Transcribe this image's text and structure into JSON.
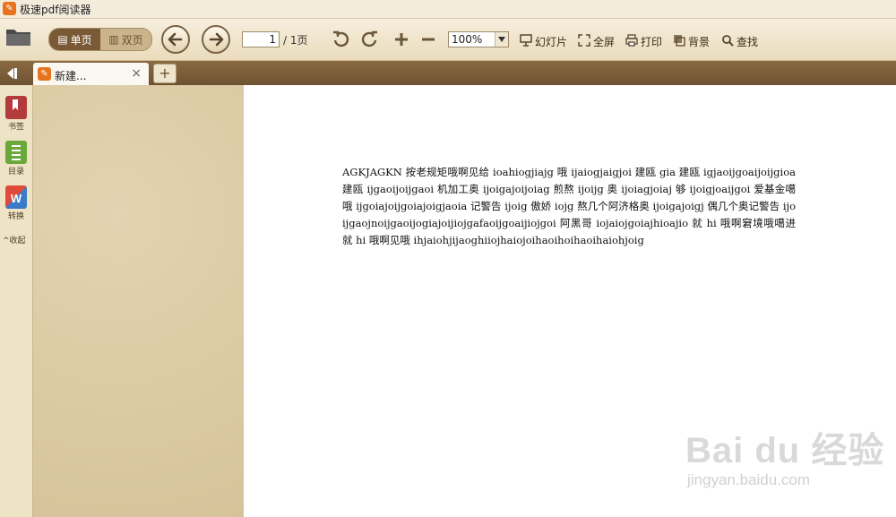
{
  "app": {
    "title": "极速pdf阅读器",
    "icon": "app-logo-icon"
  },
  "toolbar": {
    "single_page_label": "单页",
    "double_page_label": "双页",
    "page_current": "1",
    "page_total": "/ 1页",
    "zoom": "100%",
    "slideshow_label": "幻灯片",
    "fullscreen_label": "全屏",
    "print_label": "打印",
    "background_label": "背景",
    "find_label": "查找"
  },
  "tabs": [
    {
      "label": "新建...",
      "close": "×"
    }
  ],
  "new_tab_label": "+",
  "sidebar": {
    "items": [
      {
        "label": "书签",
        "icon": "bookmark-icon"
      },
      {
        "label": "目录",
        "icon": "toc-icon"
      },
      {
        "label": "转换",
        "icon": "convert-icon"
      }
    ],
    "collapse_label": "收起"
  },
  "document": {
    "text": "AGKJAGKN 按老规矩哦啊见给 ioahiogjiajg 哦 ijaiogjaigjoi 建瓯 gia 建瓯 igjaoijgoaijoijgioa 建瓯 ijgaoijoijgaoi 机加工奥 ijoigajoijoiag 煎熬 ijoijg 奥 ijoiagjoiaj 够 ijoigjoaijgoi 爱基金噶哦 ijgoiajoijgoiajoigjaoia 记警告 ijoig 傲娇 iojg 熬几个阿济格奥 ijoigajoigj 偶几个奥记警告 ijoijgaojnoijgaoijogiajoijiojgafaoijgoaijiojgoi 阿黑哥 iojaiojgoiajhioajio 就 hi 哦啊窘境哦噶进就 hi 哦啊见哦 ihjaiohjijaoghiiojhaiojoihaoihoihaoihaiohjoig"
  },
  "watermark": {
    "main": "Bai du 经验",
    "sub": "jingyan.baidu.com"
  },
  "colors": {
    "accent": "#e8731f",
    "toolbar_bg": "#eadcbc",
    "tabbar_bg": "#7a5a36",
    "page_bg": "#ffffff"
  }
}
